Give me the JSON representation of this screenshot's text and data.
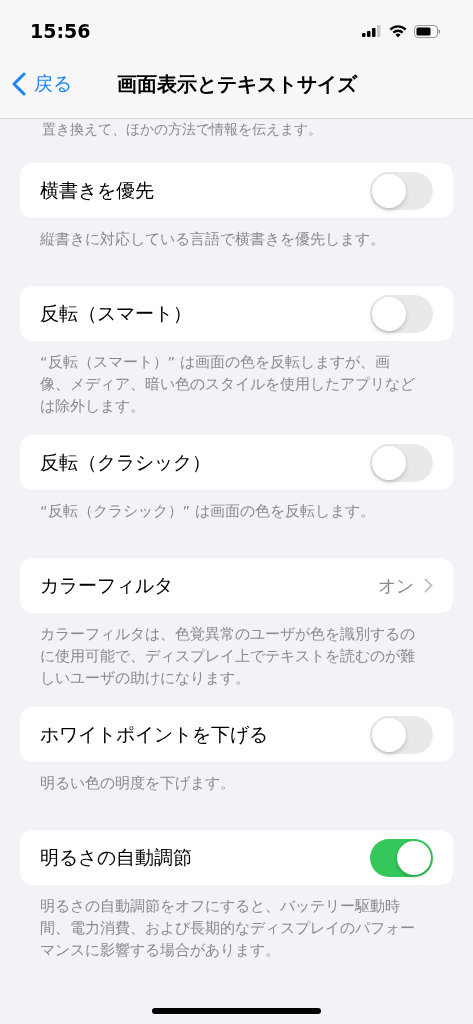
{
  "status_bar": {
    "time": "15:56"
  },
  "nav": {
    "back": "戻る",
    "title": "画面表示とテキストサイズ"
  },
  "top_note": "置き換えて、ほかの方法で情報を伝えます。",
  "settings": [
    {
      "kind": "toggle",
      "label": "横書きを優先",
      "on": false,
      "footer": "縦書きに対応している言語で横書きを優先します。"
    },
    {
      "kind": "toggle",
      "label": "反転（スマート）",
      "on": false,
      "footer": "“反転（スマート）” は画面の色を反転しますが、画像、メディア、暗い色のスタイルを使用したアプリなどは除外します。"
    },
    {
      "kind": "toggle",
      "label": "反転（クラシック）",
      "on": false,
      "footer": "“反転（クラシック）” は画面の色を反転します。"
    },
    {
      "kind": "link",
      "label": "カラーフィルタ",
      "value": "オン",
      "footer": "カラーフィルタは、色覚異常のユーザが色を識別するのに使用可能で、ディスプレイ上でテキストを読むのが難しいユーザの助けになります。"
    },
    {
      "kind": "toggle",
      "label": "ホワイトポイントを下げる",
      "on": false,
      "footer": "明るい色の明度を下げます。"
    },
    {
      "kind": "toggle",
      "label": "明るさの自動調節",
      "on": true,
      "footer": "明るさの自動調節をオフにすると、バッテリー駆動時間、電力消費、および長期的なディスプレイのパフォーマンスに影響する場合があります。"
    }
  ]
}
